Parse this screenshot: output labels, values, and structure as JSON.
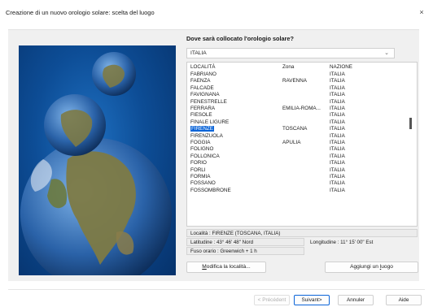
{
  "window": {
    "title": "Creazione di un nuovo orologio solare: scelta del luogo",
    "close_glyph": "×"
  },
  "question": "Dove sarà collocato l'orologio solare?",
  "country_select": {
    "value": "ITALIA"
  },
  "list": {
    "columns": [
      "LOCALITÀ",
      "Zona",
      "NAZIONE"
    ],
    "rows": [
      [
        "FABRIANO",
        "",
        "ITALIA"
      ],
      [
        "FAENZA",
        "RAVENNA",
        "ITALIA"
      ],
      [
        "FALCADE",
        "",
        "ITALIA"
      ],
      [
        "FAVIGNANA",
        "",
        "ITALIA"
      ],
      [
        "FENESTRELLE",
        "",
        "ITALIA"
      ],
      [
        "FERRARA",
        "EMILIA-ROMA...",
        "ITALIA"
      ],
      [
        "FIESOLE",
        "",
        "ITALIA"
      ],
      [
        "FINALE LIGURE",
        "",
        "ITALIA"
      ],
      [
        "FIRENZE",
        "TOSCANA",
        "ITALIA"
      ],
      [
        "FIRENZUOLA",
        "",
        "ITALIA"
      ],
      [
        "FOGGIA",
        "APULIA",
        "ITALIA"
      ],
      [
        "FOLIGNO",
        "",
        "ITALIA"
      ],
      [
        "FOLLONICA",
        "",
        "ITALIA"
      ],
      [
        "FORIO",
        "",
        "ITALIA"
      ],
      [
        "FORLI",
        "",
        "ITALIA"
      ],
      [
        "FORMIA",
        "",
        "ITALIA"
      ],
      [
        "FOSSANO",
        "",
        "ITALIA"
      ],
      [
        "FOSSOMBRONE",
        "",
        "ITALIA"
      ]
    ],
    "selected_index": 8
  },
  "info": {
    "localita": "Località : FIRENZE (TOSCANA, ITALIA)",
    "latitudine": "Latitudine : 43° 46' 48\" Nord",
    "longitudine": "Longitudine : 11° 15' 00\" Est",
    "fuso": "Fuso orario : Greenwich + 1 h"
  },
  "buttons": {
    "modifica_u": "M",
    "modifica_rest": "odifica la località...",
    "aggiungi_pre": "Aggiungi un ",
    "aggiungi_u": "l",
    "aggiungi_rest": "uogo"
  },
  "footer": {
    "precedent_pre": "< ",
    "precedent_u": "P",
    "precedent_rest": "récédent",
    "suivant_u": "S",
    "suivant_rest": "uivant>",
    "annuler": "Annuler",
    "aide": "Aide"
  }
}
